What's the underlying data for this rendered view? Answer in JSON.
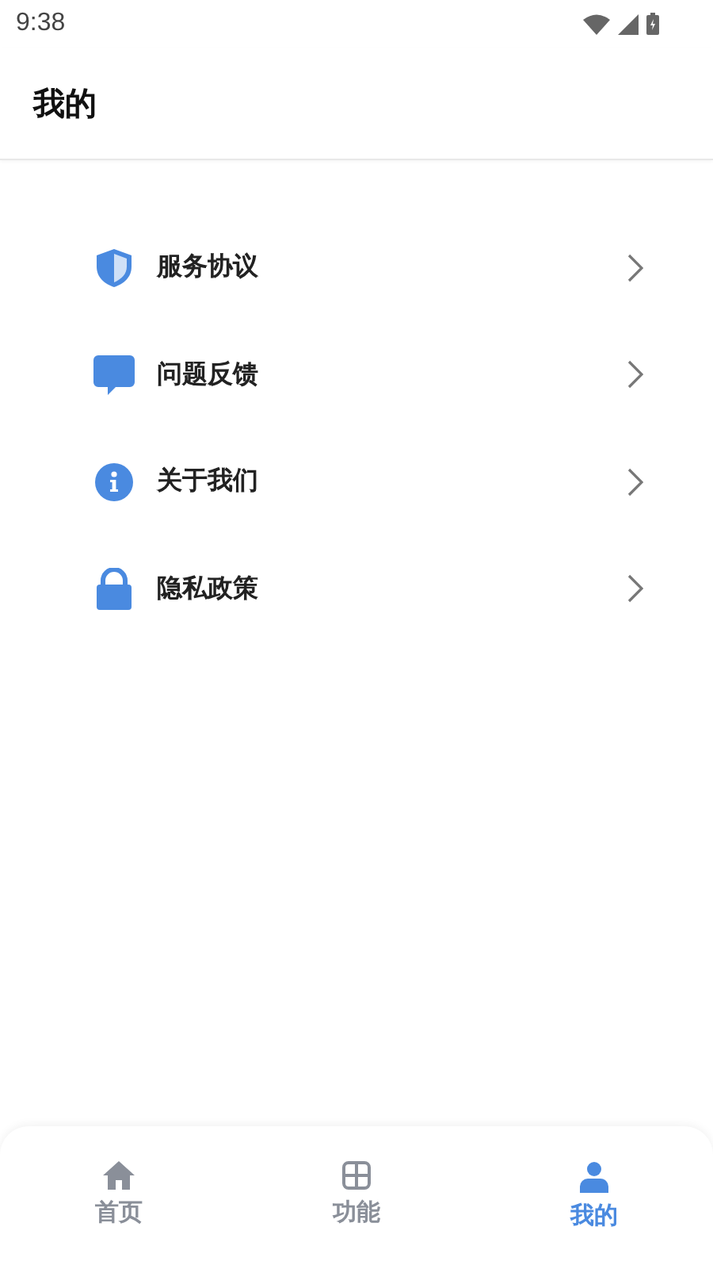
{
  "status_bar": {
    "time": "9:38"
  },
  "header": {
    "title": "我的"
  },
  "menu": [
    {
      "kind": "shield",
      "label": "服务协议"
    },
    {
      "kind": "chat",
      "label": "问题反馈"
    },
    {
      "kind": "info",
      "label": "关于我们"
    },
    {
      "kind": "lock",
      "label": "隐私政策"
    }
  ],
  "bottom_nav": [
    {
      "kind": "home",
      "label": "首页",
      "selected": false
    },
    {
      "kind": "grid",
      "label": "功能",
      "selected": false
    },
    {
      "kind": "person",
      "label": "我的",
      "selected": true
    }
  ]
}
